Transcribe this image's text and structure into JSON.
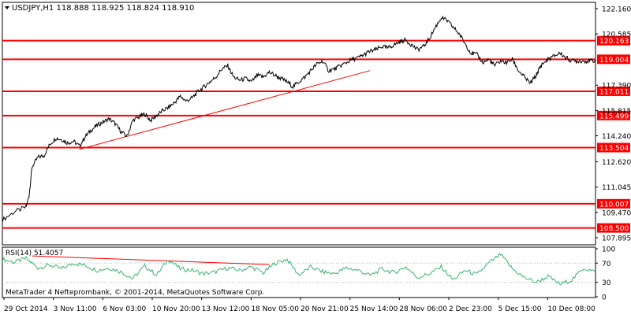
{
  "price_header": "USDJPY,H1  118.888 118.925 118.824 118.910",
  "rsi_header": "RSI(14) 51.4057",
  "copyright": "MetaTrader 4 Nefteprombank, © 2001-2014, MetaQuotes Software Corp.",
  "colors": {
    "background": "#ffffff",
    "price_line": "#000000",
    "level_line": "#ff0000",
    "trendline": "#ff0000",
    "rsi_line": "#3cb371",
    "label_bg": "#ff0000",
    "label_text": "#ffffff",
    "axis_text": "#000000",
    "frame": "#000000"
  },
  "chart_data": [
    {
      "type": "line",
      "name": "price",
      "title": "USDJPY,H1",
      "ylim": [
        107.5,
        122.5
      ],
      "y_ticks": [
        "122.160",
        "120.585",
        "117.390",
        "115.815",
        "114.240",
        "112.620",
        "111.045",
        "109.470",
        "107.895"
      ],
      "x_ticks": [
        "29 Oct 2014",
        "3 Nov 11:00",
        "6 Nov 03:00",
        "10 Nov 20:00",
        "13 Nov 12:00",
        "18 Nov 05:00",
        "20 Nov 21:00",
        "25 Nov 14:00",
        "28 Nov 06:00",
        "2 Dec 23:00",
        "5 Dec 15:00",
        "10 Dec 08:00"
      ],
      "levels": [
        {
          "value": 120.163,
          "label": "120.163"
        },
        {
          "value": 119.004,
          "label": "119.004"
        },
        {
          "value": 117.011,
          "label": "117.011"
        },
        {
          "value": 115.499,
          "label": "115.499"
        },
        {
          "value": 113.504,
          "label": "113.504"
        },
        {
          "value": 110.007,
          "label": "110.007"
        },
        {
          "value": 108.5,
          "label": "108.500"
        }
      ],
      "trendline": {
        "start": [
          0.13,
          113.4
        ],
        "end": [
          0.62,
          118.3
        ]
      },
      "x": [
        0.0,
        0.02,
        0.04,
        0.045,
        0.05,
        0.06,
        0.07,
        0.08,
        0.09,
        0.1,
        0.11,
        0.12,
        0.13,
        0.14,
        0.15,
        0.16,
        0.17,
        0.18,
        0.19,
        0.2,
        0.21,
        0.22,
        0.23,
        0.24,
        0.25,
        0.26,
        0.27,
        0.28,
        0.29,
        0.3,
        0.31,
        0.32,
        0.33,
        0.34,
        0.35,
        0.36,
        0.37,
        0.38,
        0.39,
        0.4,
        0.41,
        0.42,
        0.43,
        0.44,
        0.45,
        0.46,
        0.47,
        0.48,
        0.49,
        0.5,
        0.51,
        0.52,
        0.53,
        0.54,
        0.55,
        0.56,
        0.57,
        0.58,
        0.59,
        0.6,
        0.61,
        0.62,
        0.63,
        0.64,
        0.65,
        0.66,
        0.67,
        0.68,
        0.69,
        0.7,
        0.71,
        0.72,
        0.73,
        0.74,
        0.75,
        0.76,
        0.77,
        0.78,
        0.79,
        0.8,
        0.81,
        0.82,
        0.83,
        0.84,
        0.85,
        0.86,
        0.87,
        0.88,
        0.89,
        0.9,
        0.905,
        0.91,
        0.92,
        0.93,
        0.94,
        0.95,
        0.96,
        0.97,
        0.98,
        0.99,
        1.0
      ],
      "values": [
        109.0,
        109.5,
        109.8,
        110.5,
        112.3,
        112.9,
        113.0,
        113.7,
        114.1,
        114.0,
        113.8,
        113.9,
        113.6,
        114.2,
        114.6,
        114.9,
        115.1,
        115.3,
        115.0,
        114.5,
        114.2,
        115.2,
        115.4,
        115.6,
        115.2,
        115.5,
        115.8,
        116.0,
        116.3,
        116.7,
        116.4,
        116.6,
        117.0,
        117.3,
        117.6,
        117.9,
        118.4,
        118.6,
        117.9,
        117.7,
        117.8,
        117.6,
        118.0,
        117.9,
        118.2,
        118.0,
        117.8,
        117.6,
        117.3,
        117.6,
        117.9,
        118.3,
        118.7,
        118.9,
        118.3,
        118.4,
        118.6,
        118.8,
        119.0,
        119.1,
        119.3,
        119.5,
        119.6,
        119.8,
        119.7,
        119.9,
        120.1,
        120.2,
        119.9,
        119.6,
        119.8,
        120.3,
        121.0,
        121.6,
        121.4,
        121.0,
        120.6,
        120.0,
        119.4,
        119.3,
        118.8,
        119.0,
        118.6,
        118.9,
        118.8,
        119.0,
        118.3,
        117.9,
        117.5,
        118.0,
        118.4,
        118.7,
        119.0,
        119.2,
        119.4,
        119.1,
        118.9,
        118.9,
        118.9,
        118.9,
        118.91
      ]
    },
    {
      "type": "line",
      "name": "RSI(14)",
      "ylim": [
        0,
        100
      ],
      "y_ticks": [
        "100",
        "70",
        "30",
        "0"
      ],
      "trendline": {
        "start": [
          0.05,
          85
        ],
        "end": [
          0.45,
          67
        ]
      },
      "x": [
        0.0,
        0.02,
        0.04,
        0.06,
        0.08,
        0.1,
        0.12,
        0.14,
        0.16,
        0.18,
        0.2,
        0.22,
        0.24,
        0.26,
        0.28,
        0.3,
        0.32,
        0.34,
        0.36,
        0.38,
        0.4,
        0.42,
        0.44,
        0.46,
        0.48,
        0.5,
        0.52,
        0.54,
        0.56,
        0.58,
        0.6,
        0.62,
        0.64,
        0.66,
        0.68,
        0.7,
        0.72,
        0.74,
        0.76,
        0.78,
        0.8,
        0.82,
        0.84,
        0.86,
        0.88,
        0.9,
        0.92,
        0.94,
        0.96,
        0.98,
        1.0
      ],
      "values": [
        78,
        72,
        80,
        60,
        66,
        58,
        70,
        65,
        55,
        60,
        52,
        38,
        64,
        45,
        78,
        58,
        55,
        48,
        52,
        60,
        55,
        62,
        50,
        70,
        78,
        45,
        62,
        52,
        48,
        60,
        55,
        44,
        58,
        50,
        62,
        40,
        48,
        62,
        35,
        55,
        46,
        70,
        88,
        58,
        40,
        30,
        42,
        26,
        35,
        60,
        51
      ]
    }
  ]
}
